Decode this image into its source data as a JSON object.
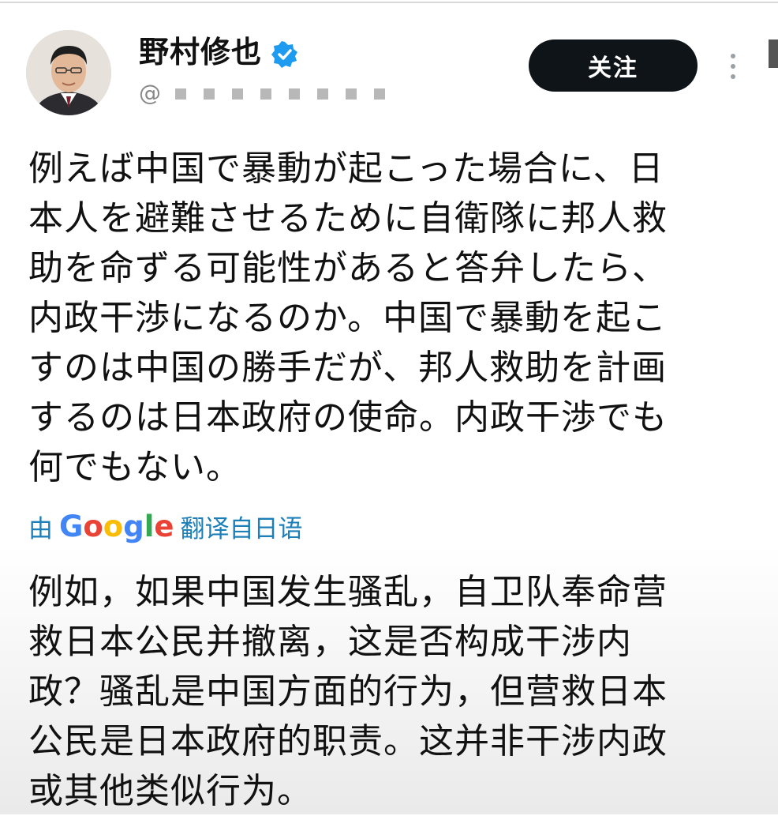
{
  "user": {
    "display_name": "野村修也",
    "handle_prefix": "@"
  },
  "actions": {
    "follow_label": "关注"
  },
  "post": {
    "text_jp": "例えば中国で暴動が起こった場合に、日\n本人を避難させるために自衛隊に邦人救\n助を命ずる可能性があると答弁したら、\n内政干渉になるのか。中国で暴動を起こ\nすのは中国の勝手だが、邦人救助を計画\nするのは日本政府の使命。内政干渉でも\n何でもない。",
    "translation_prefix": "由",
    "translation_brand": "Google",
    "translation_suffix": "翻译自日语",
    "text_zh": "例如，如果中国发生骚乱，自卫队奉命营\n救日本公民并撤离，这是否构成干涉内\n政？骚乱是中国方面的行为，但营救日本\n公民是日本政府的职责。这并非干涉内政\n或其他类似行为。"
  },
  "icons": {
    "verified": "verified-badge-icon",
    "more": "more-vertical-icon"
  },
  "colors": {
    "follow_bg": "#0f1419",
    "translation_link": "#1d7fb8",
    "verified_blue": "#1d9bf0"
  }
}
